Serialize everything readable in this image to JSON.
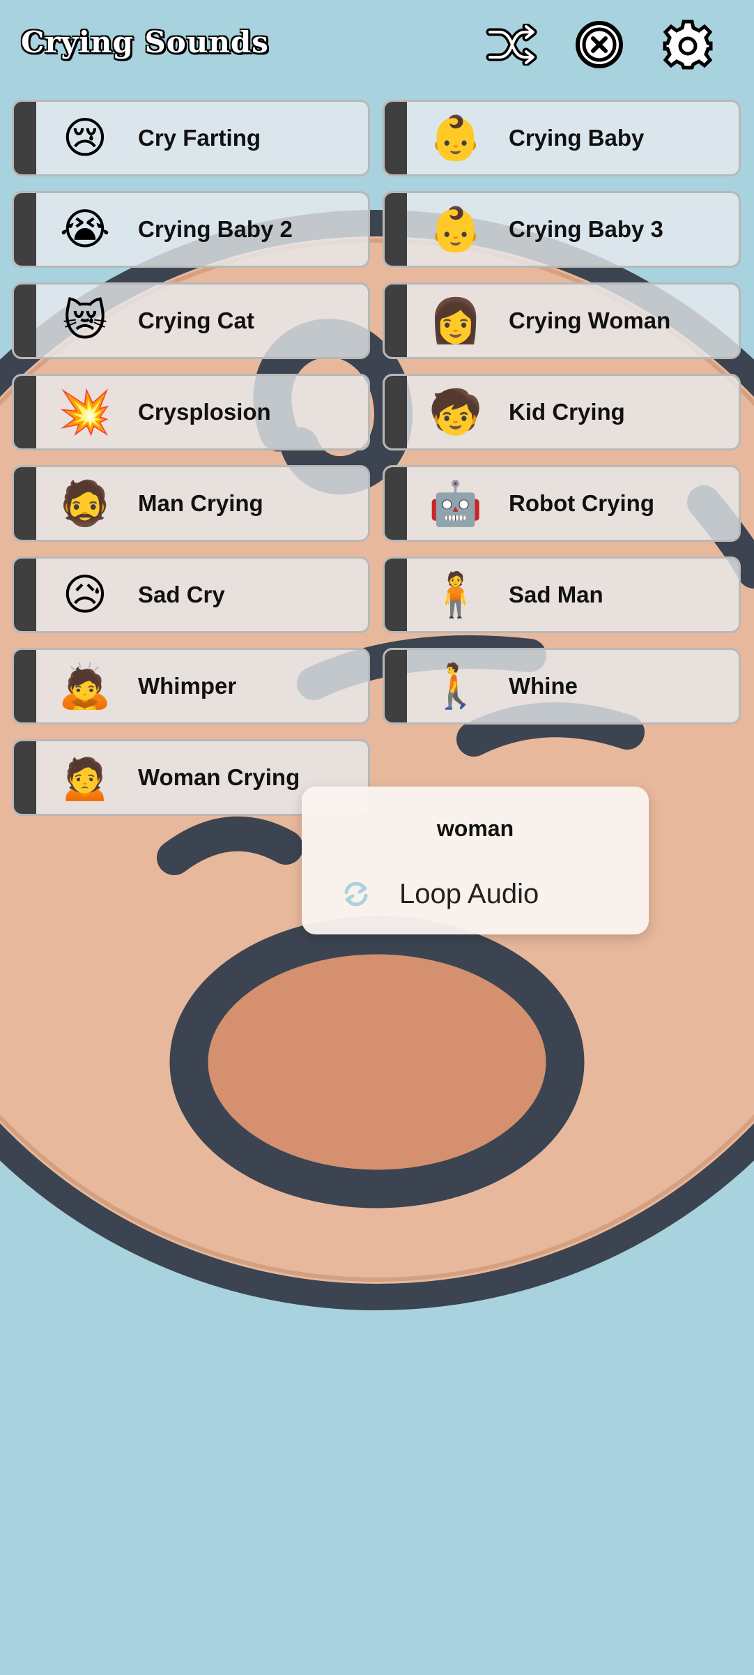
{
  "header": {
    "title": "Crying Sounds",
    "icons": [
      "shuffle-icon",
      "close-circle-icon",
      "gear-icon"
    ]
  },
  "sounds": [
    {
      "label": "Cry Farting",
      "icon": "😢"
    },
    {
      "label": "Crying Baby",
      "icon": "👶"
    },
    {
      "label": "Crying Baby 2",
      "icon": "😭"
    },
    {
      "label": "Crying Baby 3",
      "icon": "👶"
    },
    {
      "label": "Crying Cat",
      "icon": "😿"
    },
    {
      "label": "Crying Woman",
      "icon": "👩"
    },
    {
      "label": "Crysplosion",
      "icon": "💥"
    },
    {
      "label": "Kid Crying",
      "icon": "🧒"
    },
    {
      "label": "Man Crying",
      "icon": "🧔"
    },
    {
      "label": "Robot Crying",
      "icon": "🤖"
    },
    {
      "label": "Sad Cry",
      "icon": "😥"
    },
    {
      "label": "Sad Man",
      "icon": "🧍"
    },
    {
      "label": "Whimper",
      "icon": "🙇"
    },
    {
      "label": "Whine",
      "icon": "🚶"
    },
    {
      "label": "Woman Crying",
      "icon": "🙍"
    }
  ],
  "popup": {
    "title": "woman",
    "loop_label": "Loop Audio"
  },
  "colors": {
    "background": "#a9d2df",
    "tile_strip": "#3f3f3f",
    "face_skin": "#e8b89c",
    "face_outline": "#3b4450",
    "mouth_inner": "#d4906f",
    "loop_icon": "#a9d2df"
  }
}
